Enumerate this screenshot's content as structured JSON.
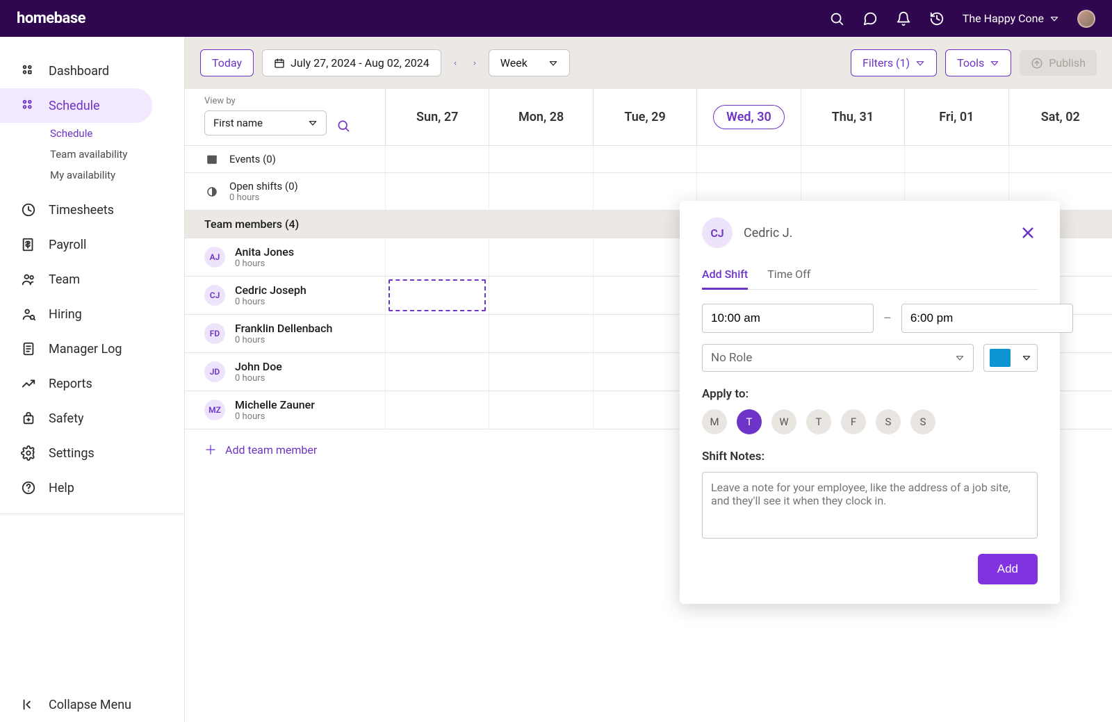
{
  "header": {
    "logo": "homebase",
    "company": "The Happy Cone"
  },
  "sidebar": {
    "items": [
      {
        "label": "Dashboard",
        "icon": "dashboard-icon"
      },
      {
        "label": "Schedule",
        "icon": "schedule-icon",
        "active": true
      },
      {
        "label": "Timesheets",
        "icon": "clock-icon"
      },
      {
        "label": "Payroll",
        "icon": "payroll-icon"
      },
      {
        "label": "Team",
        "icon": "team-icon"
      },
      {
        "label": "Hiring",
        "icon": "hiring-icon"
      },
      {
        "label": "Manager Log",
        "icon": "log-icon"
      },
      {
        "label": "Reports",
        "icon": "reports-icon"
      },
      {
        "label": "Safety",
        "icon": "safety-icon"
      },
      {
        "label": "Settings",
        "icon": "settings-icon"
      },
      {
        "label": "Help",
        "icon": "help-icon"
      }
    ],
    "subitems": [
      {
        "label": "Schedule",
        "active": true
      },
      {
        "label": "Team availability"
      },
      {
        "label": "My availability"
      }
    ],
    "collapse": "Collapse Menu"
  },
  "toolbar": {
    "today": "Today",
    "daterange": "July 27, 2024 - Aug 02, 2024",
    "gran": "Week",
    "filters": "Filters (1)",
    "tools": "Tools",
    "publish": "Publish"
  },
  "schedule": {
    "viewby_label": "View by",
    "viewby_value": "First name",
    "days": [
      "Sun, 27",
      "Mon, 28",
      "Tue, 29",
      "Wed, 30",
      "Thu, 31",
      "Fri, 01",
      "Sat, 02"
    ],
    "today_index": 3,
    "events_label": "Events (0)",
    "open_shifts_label": "Open shifts (0)",
    "open_shifts_sub": "0 hours",
    "team_section": "Team members (4)",
    "members": [
      {
        "initials": "AJ",
        "name": "Anita Jones",
        "hours": "0 hours"
      },
      {
        "initials": "CJ",
        "name": "Cedric Joseph",
        "hours": "0 hours"
      },
      {
        "initials": "FD",
        "name": "Franklin Dellenbach",
        "hours": "0 hours"
      },
      {
        "initials": "JD",
        "name": "John Doe",
        "hours": "0 hours"
      },
      {
        "initials": "MZ",
        "name": "Michelle Zauner",
        "hours": "0 hours"
      }
    ],
    "add_member": "Add team member"
  },
  "popup": {
    "initials": "CJ",
    "name": "Cedric J.",
    "tabs": [
      "Add Shift",
      "Time Off"
    ],
    "active_tab": 0,
    "start_time": "10:00 am",
    "end_time": "6:00 pm",
    "role": "No Role",
    "color": "#0d94d2",
    "apply_label": "Apply to:",
    "days": [
      "M",
      "T",
      "W",
      "T",
      "F",
      "S",
      "S"
    ],
    "days_active_index": 1,
    "notes_label": "Shift Notes:",
    "notes_placeholder": "Leave a note for your employee, like the address of a job site, and they'll see it when they clock in.",
    "add_button": "Add"
  }
}
